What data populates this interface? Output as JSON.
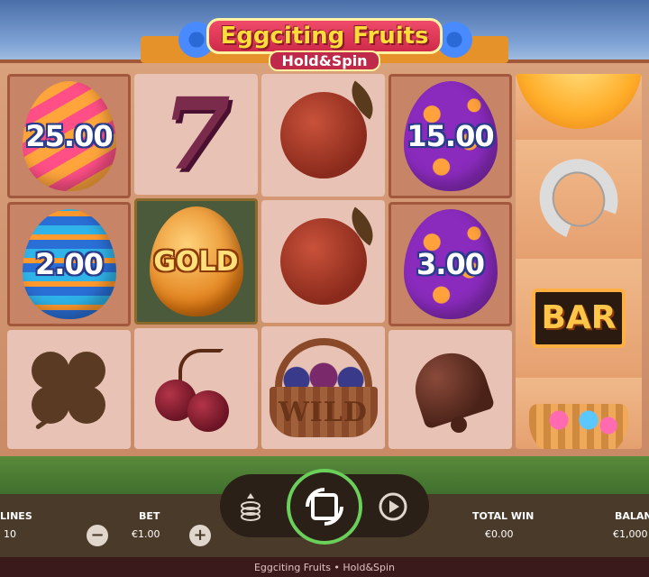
{
  "game": {
    "title": "Eggciting Fruits",
    "subtitle": "Hold&Spin",
    "footer_text": "Eggciting Fruits • Hold&Spin"
  },
  "reels": [
    [
      {
        "symbol": "egg",
        "style": "stripe-pink",
        "value": "25.00",
        "held": true
      },
      {
        "symbol": "egg",
        "style": "zigzag-blue",
        "value": "2.00",
        "held": true
      },
      {
        "symbol": "clover",
        "held": false
      }
    ],
    [
      {
        "symbol": "seven",
        "label": "7",
        "held": false
      },
      {
        "symbol": "gold-egg",
        "value": "GOLD",
        "held": true
      },
      {
        "symbol": "cherries",
        "held": false
      }
    ],
    [
      {
        "symbol": "orange",
        "held": false
      },
      {
        "symbol": "orange",
        "held": false
      },
      {
        "symbol": "wild-basket",
        "label": "WILD",
        "held": false
      }
    ],
    [
      {
        "symbol": "egg",
        "style": "dots-purple",
        "value": "15.00",
        "held": true
      },
      {
        "symbol": "egg",
        "style": "dots-purple",
        "value": "3.00",
        "held": true
      },
      {
        "symbol": "bell",
        "held": false
      }
    ],
    [
      {
        "symbol": "orange-slice",
        "held": false
      },
      {
        "symbol": "horseshoe",
        "held": false
      },
      {
        "symbol": "bar",
        "label": "BAR",
        "held": false
      },
      {
        "symbol": "basket",
        "held": false
      }
    ]
  ],
  "controls": {
    "paylines_label": "LINES",
    "paylines_value": "10",
    "bet_label": "BET",
    "bet_value": "€1.00",
    "bet_decrease_icon": "minus-icon",
    "bet_increase_icon": "plus-icon",
    "total_win_label": "TOTAL WIN",
    "total_win_value": "€0.00",
    "balance_label": "BALAN",
    "balance_value": "€1,000",
    "spin_icon": "spin-icon",
    "coins_icon": "coin-stack-icon",
    "autoplay_icon": "autoplay-icon"
  },
  "colors": {
    "accent_green": "#6ad05a",
    "frame": "#d9a17c",
    "egg_value_outline": "#2a3b8c"
  }
}
